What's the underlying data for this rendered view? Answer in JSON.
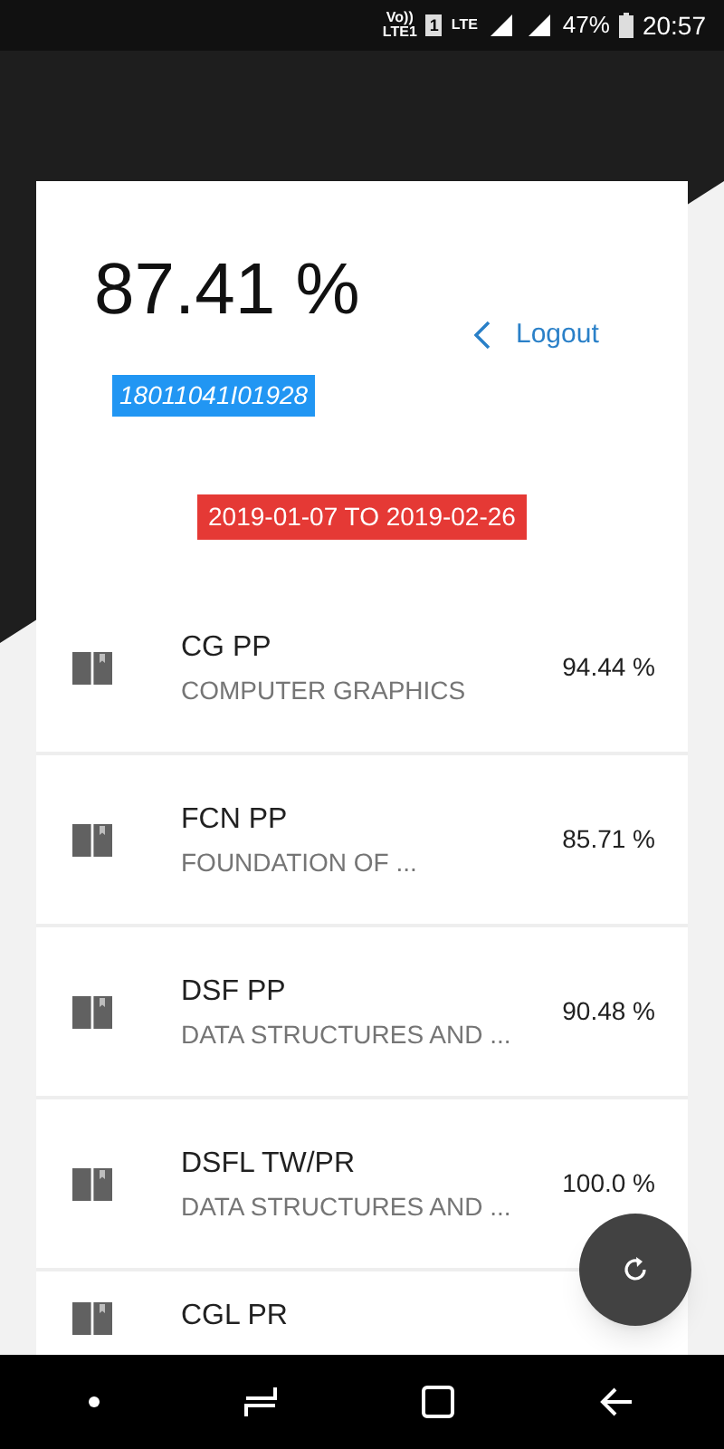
{
  "status_bar": {
    "volte": "Vo))",
    "volte_sub": "LTE1",
    "sim": "1",
    "network": "LTE",
    "battery": "47%",
    "time": "20:57"
  },
  "header": {
    "percentage": "87.41 %",
    "student_id": "18011041I01928",
    "logout": "Logout",
    "date_range": "2019-01-07 TO 2019-02-26"
  },
  "subjects": [
    {
      "code": "CG PP",
      "name": "COMPUTER GRAPHICS",
      "percentage": "94.44 %"
    },
    {
      "code": "FCN PP",
      "name": "FOUNDATION OF ...",
      "percentage": "85.71 %"
    },
    {
      "code": "DSF PP",
      "name": "DATA STRUCTURES AND ...",
      "percentage": "90.48 %"
    },
    {
      "code": "DSFL TW/PR",
      "name": "DATA STRUCTURES AND ...",
      "percentage": "100.0 %"
    },
    {
      "code": "CGL PR"
    }
  ]
}
